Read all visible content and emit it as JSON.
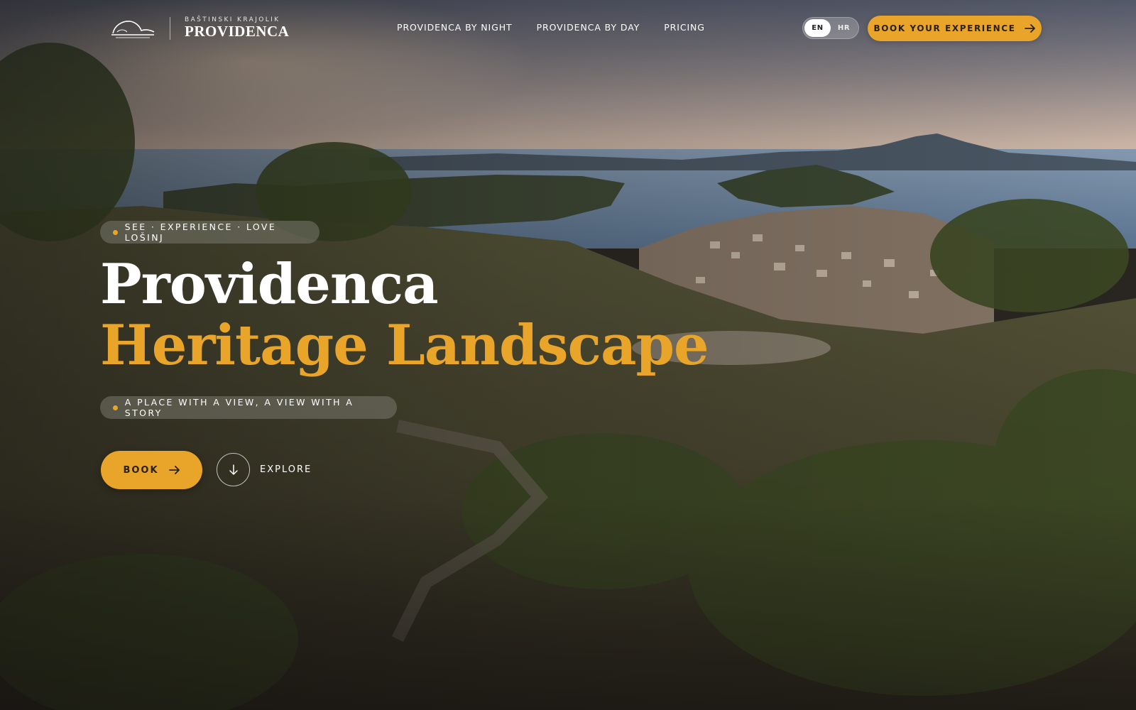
{
  "brand": {
    "subtitle": "BAŠTINSKI KRAJOLIK",
    "name": "PROVIDENCA"
  },
  "nav": {
    "items": [
      {
        "label": "PROVIDENCA BY NIGHT"
      },
      {
        "label": "PROVIDENCA BY DAY"
      },
      {
        "label": "PRICING"
      }
    ]
  },
  "language": {
    "options": [
      "EN",
      "HR"
    ],
    "selected": "EN"
  },
  "header_cta": {
    "label": "BOOK YOUR EXPERIENCE",
    "icon": "arrow-right-icon"
  },
  "hero": {
    "eyebrow": "SEE · EXPERIENCE · LOVE LOŠINJ",
    "title_line1": "Providenca",
    "title_line2": "Heritage Landscape",
    "tagline": "A PLACE WITH A VIEW, A VIEW WITH A STORY",
    "primary_button": "BOOK",
    "secondary_button": "EXPLORE",
    "secondary_icon": "arrow-down-icon"
  },
  "colors": {
    "accent": "#e8a52a",
    "text": "#ffffff",
    "button_text": "#2a2014"
  }
}
